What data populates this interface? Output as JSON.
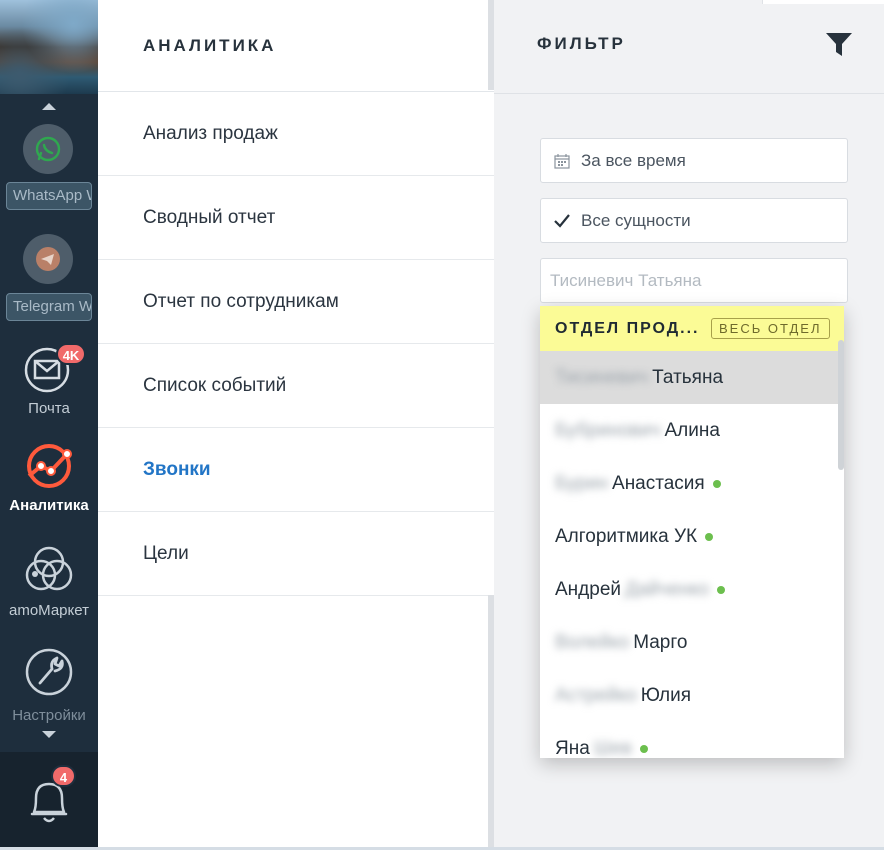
{
  "sidebar": {
    "apps": [
      {
        "label": "WhatsApp W",
        "icon": "whatsapp-icon"
      },
      {
        "label": "Telegram W",
        "icon": "telegram-icon"
      }
    ],
    "nav": [
      {
        "label": "Почта",
        "icon": "mail-icon",
        "badge": "4K"
      },
      {
        "label": "Аналитика",
        "icon": "analytics-icon",
        "active": true
      },
      {
        "label": "amoМаркет",
        "icon": "market-icon"
      },
      {
        "label": "Настройки",
        "icon": "settings-icon"
      }
    ],
    "notifications_badge": "4"
  },
  "menu": {
    "title": "АНАЛИТИКА",
    "items": [
      {
        "label": "Анализ продаж"
      },
      {
        "label": "Сводный отчет"
      },
      {
        "label": "Отчет по сотрудникам"
      },
      {
        "label": "Список событий"
      },
      {
        "label": "Звонки",
        "active": true
      },
      {
        "label": "Цели"
      }
    ]
  },
  "filter": {
    "title": "ФИЛЬТР",
    "period": "За все время",
    "entities": "Все сущности",
    "user_search_placeholder": "Тисиневич Татьяна",
    "department": {
      "name": "ОТДЕЛ ПРОД...",
      "select_all": "ВЕСЬ ОТДЕЛ"
    },
    "users": [
      {
        "first": "",
        "last_blurred": "Тисиневич",
        "name": "Татьяна",
        "online": false
      },
      {
        "first": "",
        "last_blurred": "Бубринович",
        "name": "Алина",
        "online": false
      },
      {
        "first": "",
        "last_blurred": "Бурин",
        "name": "Анастасия",
        "online": true
      },
      {
        "first": "",
        "last_blurred": "",
        "name": "Алгоритмика УК",
        "online": true
      },
      {
        "first": "Андрей",
        "last_blurred": "Дайченко",
        "name": "",
        "online": true
      },
      {
        "first": "",
        "last_blurred": "Волейко",
        "name": "Марго",
        "online": false
      },
      {
        "first": "",
        "last_blurred": "Астрейко",
        "name": "Юлия",
        "online": false
      },
      {
        "first": "Яна",
        "last_blurred": "Шев",
        "name": "",
        "online": true
      }
    ]
  },
  "colors": {
    "sidebar_bg": "#1e2e3d",
    "accent_blue": "#2275c6",
    "badge_red": "#f16a6a",
    "analytics_orange": "#ff5a3c",
    "department_yellow": "#fbfb96",
    "online_green": "#6cbf4e"
  }
}
